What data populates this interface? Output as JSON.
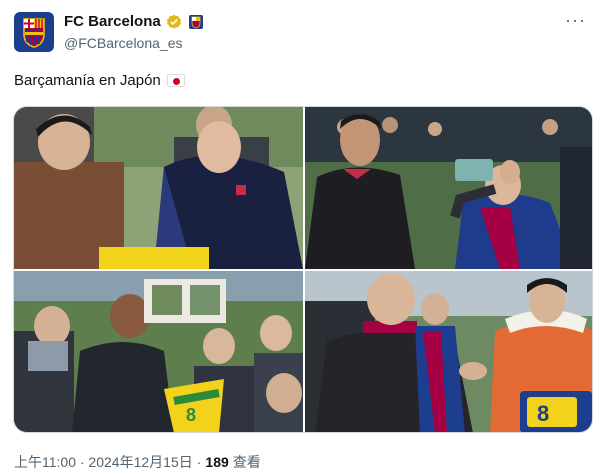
{
  "tweet": {
    "display_name": "FC Barcelona",
    "handle": "@FCBarcelona_es",
    "text": "Barçamanía en Japón",
    "text_emoji": "flag-japan-icon",
    "more_label": "···",
    "timestamp": "上午11:00 · 2024年12月15日",
    "separator": "·",
    "views_count": "189",
    "views_label": "查看"
  },
  "photos": [
    {
      "scene": "player signing autograph for fan in brown coat"
    },
    {
      "scene": "coach walking past fan taking photo with phone"
    },
    {
      "scene": "player in black jacket signing items among crowd"
    },
    {
      "scene": "bald player shaking hands with fan in orange jacket"
    }
  ],
  "photo_text": {
    "shirt_number": "8"
  },
  "colors": {
    "blaugrana_blue": "#1d3d8f",
    "blaugrana_red": "#a50044",
    "verified_gold": "#e2b719",
    "muted_text": "#536471"
  }
}
